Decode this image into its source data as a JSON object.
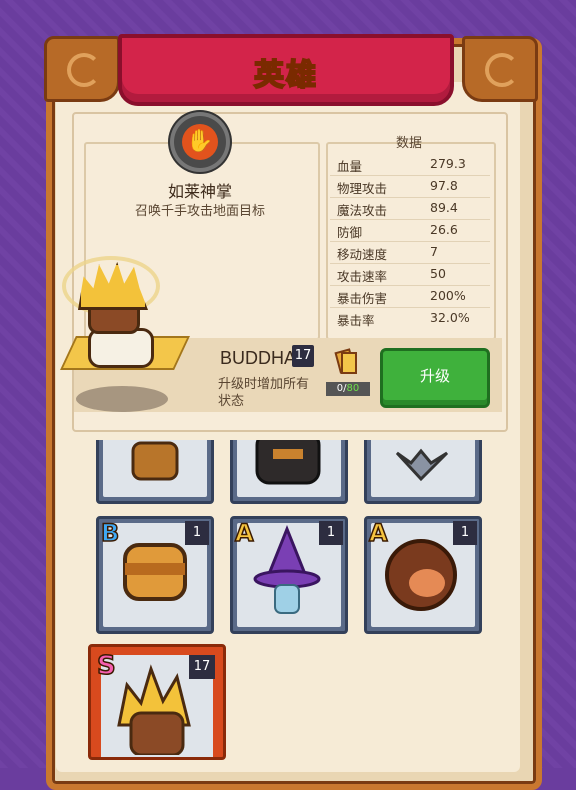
{
  "title": "英雄",
  "skill": {
    "icon": "hand-icon",
    "name": "如莱神掌",
    "description": "召唤千手攻击地面目标"
  },
  "stats": {
    "heading": "数据",
    "rows": [
      {
        "label": "血量",
        "value": "279.3"
      },
      {
        "label": "物理攻击",
        "value": "97.8"
      },
      {
        "label": "魔法攻击",
        "value": "89.4"
      },
      {
        "label": "防御",
        "value": "26.6"
      },
      {
        "label": "移动速度",
        "value": "7"
      },
      {
        "label": "攻击速率",
        "value": "50"
      },
      {
        "label": "暴击伤害",
        "value": "200%"
      },
      {
        "label": "暴击率",
        "value": "32.0%"
      }
    ]
  },
  "hero": {
    "name": "BUDDHA",
    "level": "17",
    "description": "升级时增加所有状态",
    "progress_current": "0",
    "progress_max": "80",
    "upgrade_label": "升级"
  },
  "cards": [
    {
      "rank": "B",
      "count": "1",
      "rank_color": "#3fa9f5"
    },
    {
      "rank": "A",
      "count": "1",
      "rank_color": "#f5c33f"
    },
    {
      "rank": "A",
      "count": "1",
      "rank_color": "#f5c33f"
    },
    {
      "rank": "S",
      "count": "17",
      "rank_color": "#f55fae"
    }
  ],
  "colors": {
    "background": "#6a3d9e",
    "banner": "#d3244a",
    "upgrade_button": "#3fb13c"
  }
}
